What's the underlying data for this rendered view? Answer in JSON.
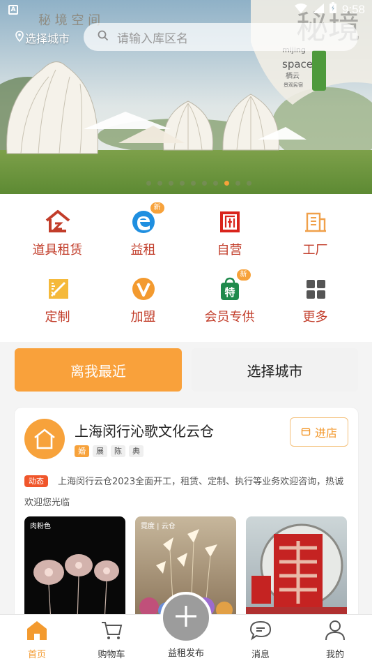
{
  "status": {
    "time": "9:58",
    "left_badge": "A"
  },
  "header": {
    "city_label": "选择城市",
    "search_placeholder": "请输入库区名"
  },
  "banner": {
    "watermark_top": "秘 境 空 间",
    "brand_en_1": "mijing",
    "brand_en_2": "space",
    "brand_cn": "栖云",
    "brand_sub": "景观民宿",
    "slide_count": 8,
    "active_slide": 7
  },
  "categories": [
    {
      "label": "道具租赁",
      "icon": "house-outline-icon",
      "badge": ""
    },
    {
      "label": "益租",
      "icon": "edge-e-icon",
      "badge": "新"
    },
    {
      "label": "自营",
      "icon": "store-icon",
      "badge": ""
    },
    {
      "label": "工厂",
      "icon": "building-icon",
      "badge": ""
    },
    {
      "label": "定制",
      "icon": "ruler-pencil-icon",
      "badge": ""
    },
    {
      "label": "加盟",
      "icon": "v-circle-icon",
      "badge": ""
    },
    {
      "label": "会员专供",
      "icon": "special-bag-icon",
      "badge": "新"
    },
    {
      "label": "更多",
      "icon": "grid-icon",
      "badge": ""
    }
  ],
  "actions": {
    "nearest": "离我最近",
    "choose_city": "选择城市"
  },
  "store": {
    "name": "上海闵行沁歌文化云仓",
    "tags": [
      "婚",
      "展",
      "陈",
      "典"
    ],
    "enter_label": "进店",
    "news_badge": "动态",
    "news_text": "上海闵行云仓2023全面开工，租赁、定制、执行等业务欢迎咨询，热诚欢迎您光临",
    "photos": [
      {
        "caption": "肉粉色"
      },
      {
        "caption": "霓度 | 云仓"
      },
      {
        "caption": ""
      }
    ]
  },
  "tabbar": [
    {
      "label": "首页",
      "icon": "home-icon",
      "active": true
    },
    {
      "label": "购物车",
      "icon": "cart-icon",
      "active": false
    },
    {
      "label": "益租发布",
      "icon": "plus-icon",
      "active": false
    },
    {
      "label": "消息",
      "icon": "message-icon",
      "active": false
    },
    {
      "label": "我的",
      "icon": "user-icon",
      "active": false
    }
  ],
  "colors": {
    "accent": "#f9a13b",
    "category_text": "#c23d2a",
    "news_badge": "#f0562b"
  }
}
